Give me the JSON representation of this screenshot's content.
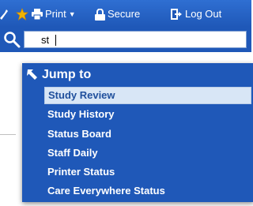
{
  "toolbar": {
    "print_label": "Print",
    "secure_label": "Secure",
    "logout_label": "Log Out",
    "icons": [
      "wrench-icon",
      "star-icon",
      "printer-icon",
      "lock-icon",
      "logout-icon"
    ]
  },
  "search": {
    "value": "st"
  },
  "jump": {
    "heading": "Jump to",
    "items": [
      "Study Review",
      "Study History",
      "Status Board",
      "Staff Daily",
      "Printer Status",
      "Care Everywhere Status"
    ],
    "selected_index": 0
  },
  "colors": {
    "toolbar_bg": "#1f58b8",
    "selected_bg": "#d8e6f6",
    "star": "#f0b400"
  }
}
